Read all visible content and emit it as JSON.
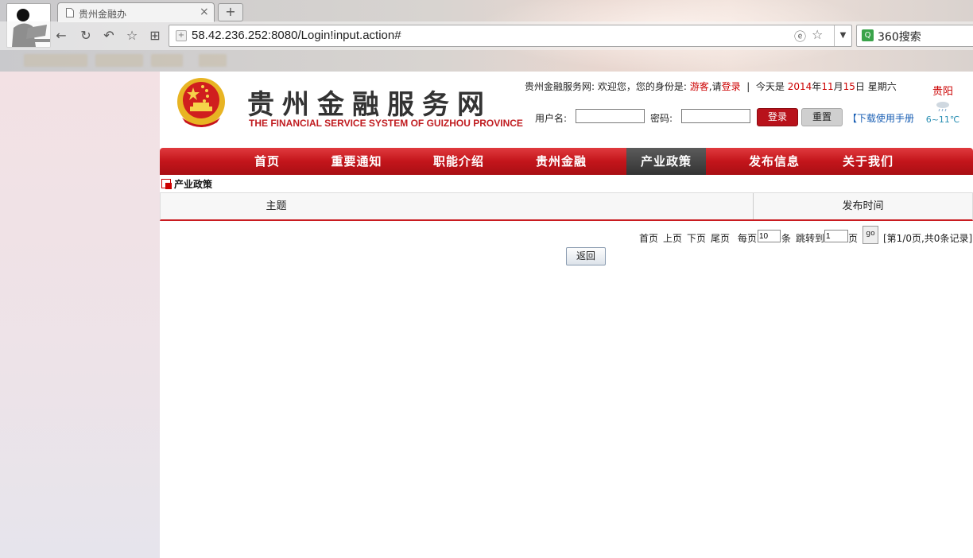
{
  "browser": {
    "tab_title": "贵州金融办",
    "new_tab_label": "+",
    "close_label": "×",
    "url": "58.42.236.252:8080/Login!input.action#",
    "search_label": "360搜索"
  },
  "header": {
    "site_title": "贵州金融服务网",
    "site_subtitle": "THE FINANCIAL SERVICE SYSTEM OF GUIZHOU PROVINCE",
    "welcome_prefix": "贵州金融服务网:  欢迎您，您的身份是:",
    "role": "游客",
    "please": ",请",
    "login_link": "登录",
    "separator": "|",
    "today_label": "今天是",
    "year": "2014",
    "year_unit": "年",
    "month": "11",
    "month_unit": "月",
    "day": "15",
    "day_unit": "日",
    "weekday": "星期六",
    "username_label": "用户名:",
    "password_label": "密码:",
    "login_button": "登录",
    "reset_button": "重置",
    "manual_link": "【下载使用手册"
  },
  "weather": {
    "city": "贵阳",
    "icon": "rain-cloud-icon",
    "temp": "6~11℃"
  },
  "nav": {
    "items": [
      "首页",
      "重要通知",
      "职能介绍",
      "贵州金融",
      "产业政策",
      "发布信息",
      "关于我们"
    ],
    "active": "产业政策"
  },
  "breadcrumb": {
    "current": "产业政策"
  },
  "table": {
    "col_subject": "主题",
    "col_date": "发布时间"
  },
  "pager": {
    "first": "首页",
    "prev": "上页",
    "next": "下页",
    "last": "尾页",
    "per_page_label": "每页",
    "per_page_value": "10",
    "per_page_unit": "条",
    "jump_label": "跳转到",
    "jump_value": "1",
    "jump_unit": "页",
    "go_label": "go",
    "summary": "[第1/0页,共0条记录]"
  },
  "back_button": "返回",
  "colors": {
    "brand_red": "#c3151b",
    "active_nav": "#444444",
    "link_blue": "#1a5fb4"
  }
}
